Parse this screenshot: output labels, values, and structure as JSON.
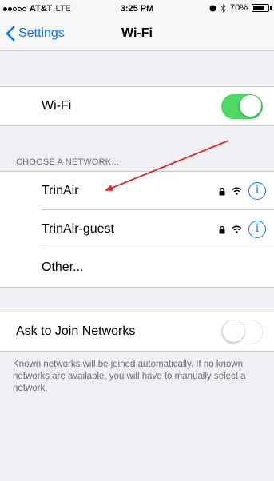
{
  "status_bar": {
    "signal_dots": 5,
    "signal_dots_filled": 2,
    "carrier": "AT&T",
    "network_type": "LTE",
    "time": "3:25 PM",
    "battery_percent": "70%",
    "battery_level": 0.7
  },
  "nav": {
    "back_label": "Settings",
    "title": "Wi-Fi"
  },
  "wifi_row": {
    "label": "Wi-Fi",
    "enabled": true
  },
  "networks_section": {
    "header": "CHOOSE A NETWORK...",
    "networks": [
      {
        "name": "TrinAir",
        "secured": true
      },
      {
        "name": "TrinAir-guest",
        "secured": true
      }
    ],
    "other_label": "Other..."
  },
  "ask_row": {
    "label": "Ask to Join Networks",
    "enabled": false
  },
  "footer": {
    "text": "Known networks will be joined automatically. If no known networks are available, you will have to manually select a network."
  },
  "colors": {
    "accent": "#007aff",
    "switch_on": "#4cd964",
    "annotation_arrow": "#e0262b",
    "background": "#efeff4"
  },
  "icons": [
    "wifi-icon",
    "bluetooth-icon",
    "battery-icon",
    "chevron-left-icon",
    "lock-icon",
    "info-icon"
  ]
}
